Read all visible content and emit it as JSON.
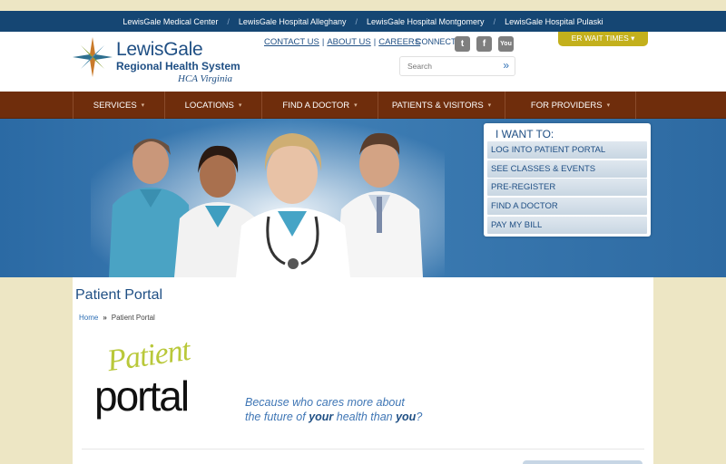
{
  "hospital_links": [
    "LewisGale Medical Center",
    "LewisGale Hospital Alleghany",
    "LewisGale Hospital Montgomery",
    "LewisGale Hospital Pulaski"
  ],
  "hospital_separator": "/",
  "logo": {
    "title": "LewisGale",
    "subtitle": "Regional Health System",
    "tagline": "HCA Virginia"
  },
  "utility_links": {
    "contact": "CONTACT US",
    "about": "ABOUT US",
    "careers": "CAREERS",
    "separator": "|"
  },
  "connect_label": "CONNECT",
  "social": {
    "twitter": {
      "icon": "twitter-icon",
      "glyph": "t"
    },
    "facebook": {
      "icon": "facebook-icon",
      "glyph": "f"
    },
    "youtube": {
      "icon": "youtube-icon",
      "glyph": "You"
    }
  },
  "search": {
    "placeholder": "Search",
    "submit_glyph": "»"
  },
  "er_button": "ER WAIT TIMES ▾",
  "nav": [
    {
      "label": "SERVICES"
    },
    {
      "label": "LOCATIONS"
    },
    {
      "label": "FIND A DOCTOR"
    },
    {
      "label": "PATIENTS & VISITORS"
    },
    {
      "label": "FOR PROVIDERS"
    }
  ],
  "nav_caret": "▾",
  "i_want": {
    "title": "I WANT TO:",
    "options": [
      "LOG INTO PATIENT PORTAL",
      "SEE CLASSES & EVENTS",
      "PRE-REGISTER",
      "FIND A DOCTOR",
      "PAY MY BILL"
    ]
  },
  "page": {
    "title": "Patient Portal",
    "breadcrumb_home": "Home",
    "breadcrumb_sep": "»",
    "breadcrumb_current": "Patient Portal"
  },
  "portal_logo": {
    "script": "Patient",
    "word": "portal"
  },
  "tagline": {
    "line1": "Because who cares more about",
    "line2_a": "the future of ",
    "line2_b": "your",
    "line2_c": " health than ",
    "line2_d": "you",
    "line2_e": "?"
  },
  "colors": {
    "navy": "#154673",
    "brand_blue": "#1f4f84",
    "nav_brown": "#6f2d0c",
    "er_gold": "#c3b01c",
    "page_bg": "#ede6c4"
  }
}
